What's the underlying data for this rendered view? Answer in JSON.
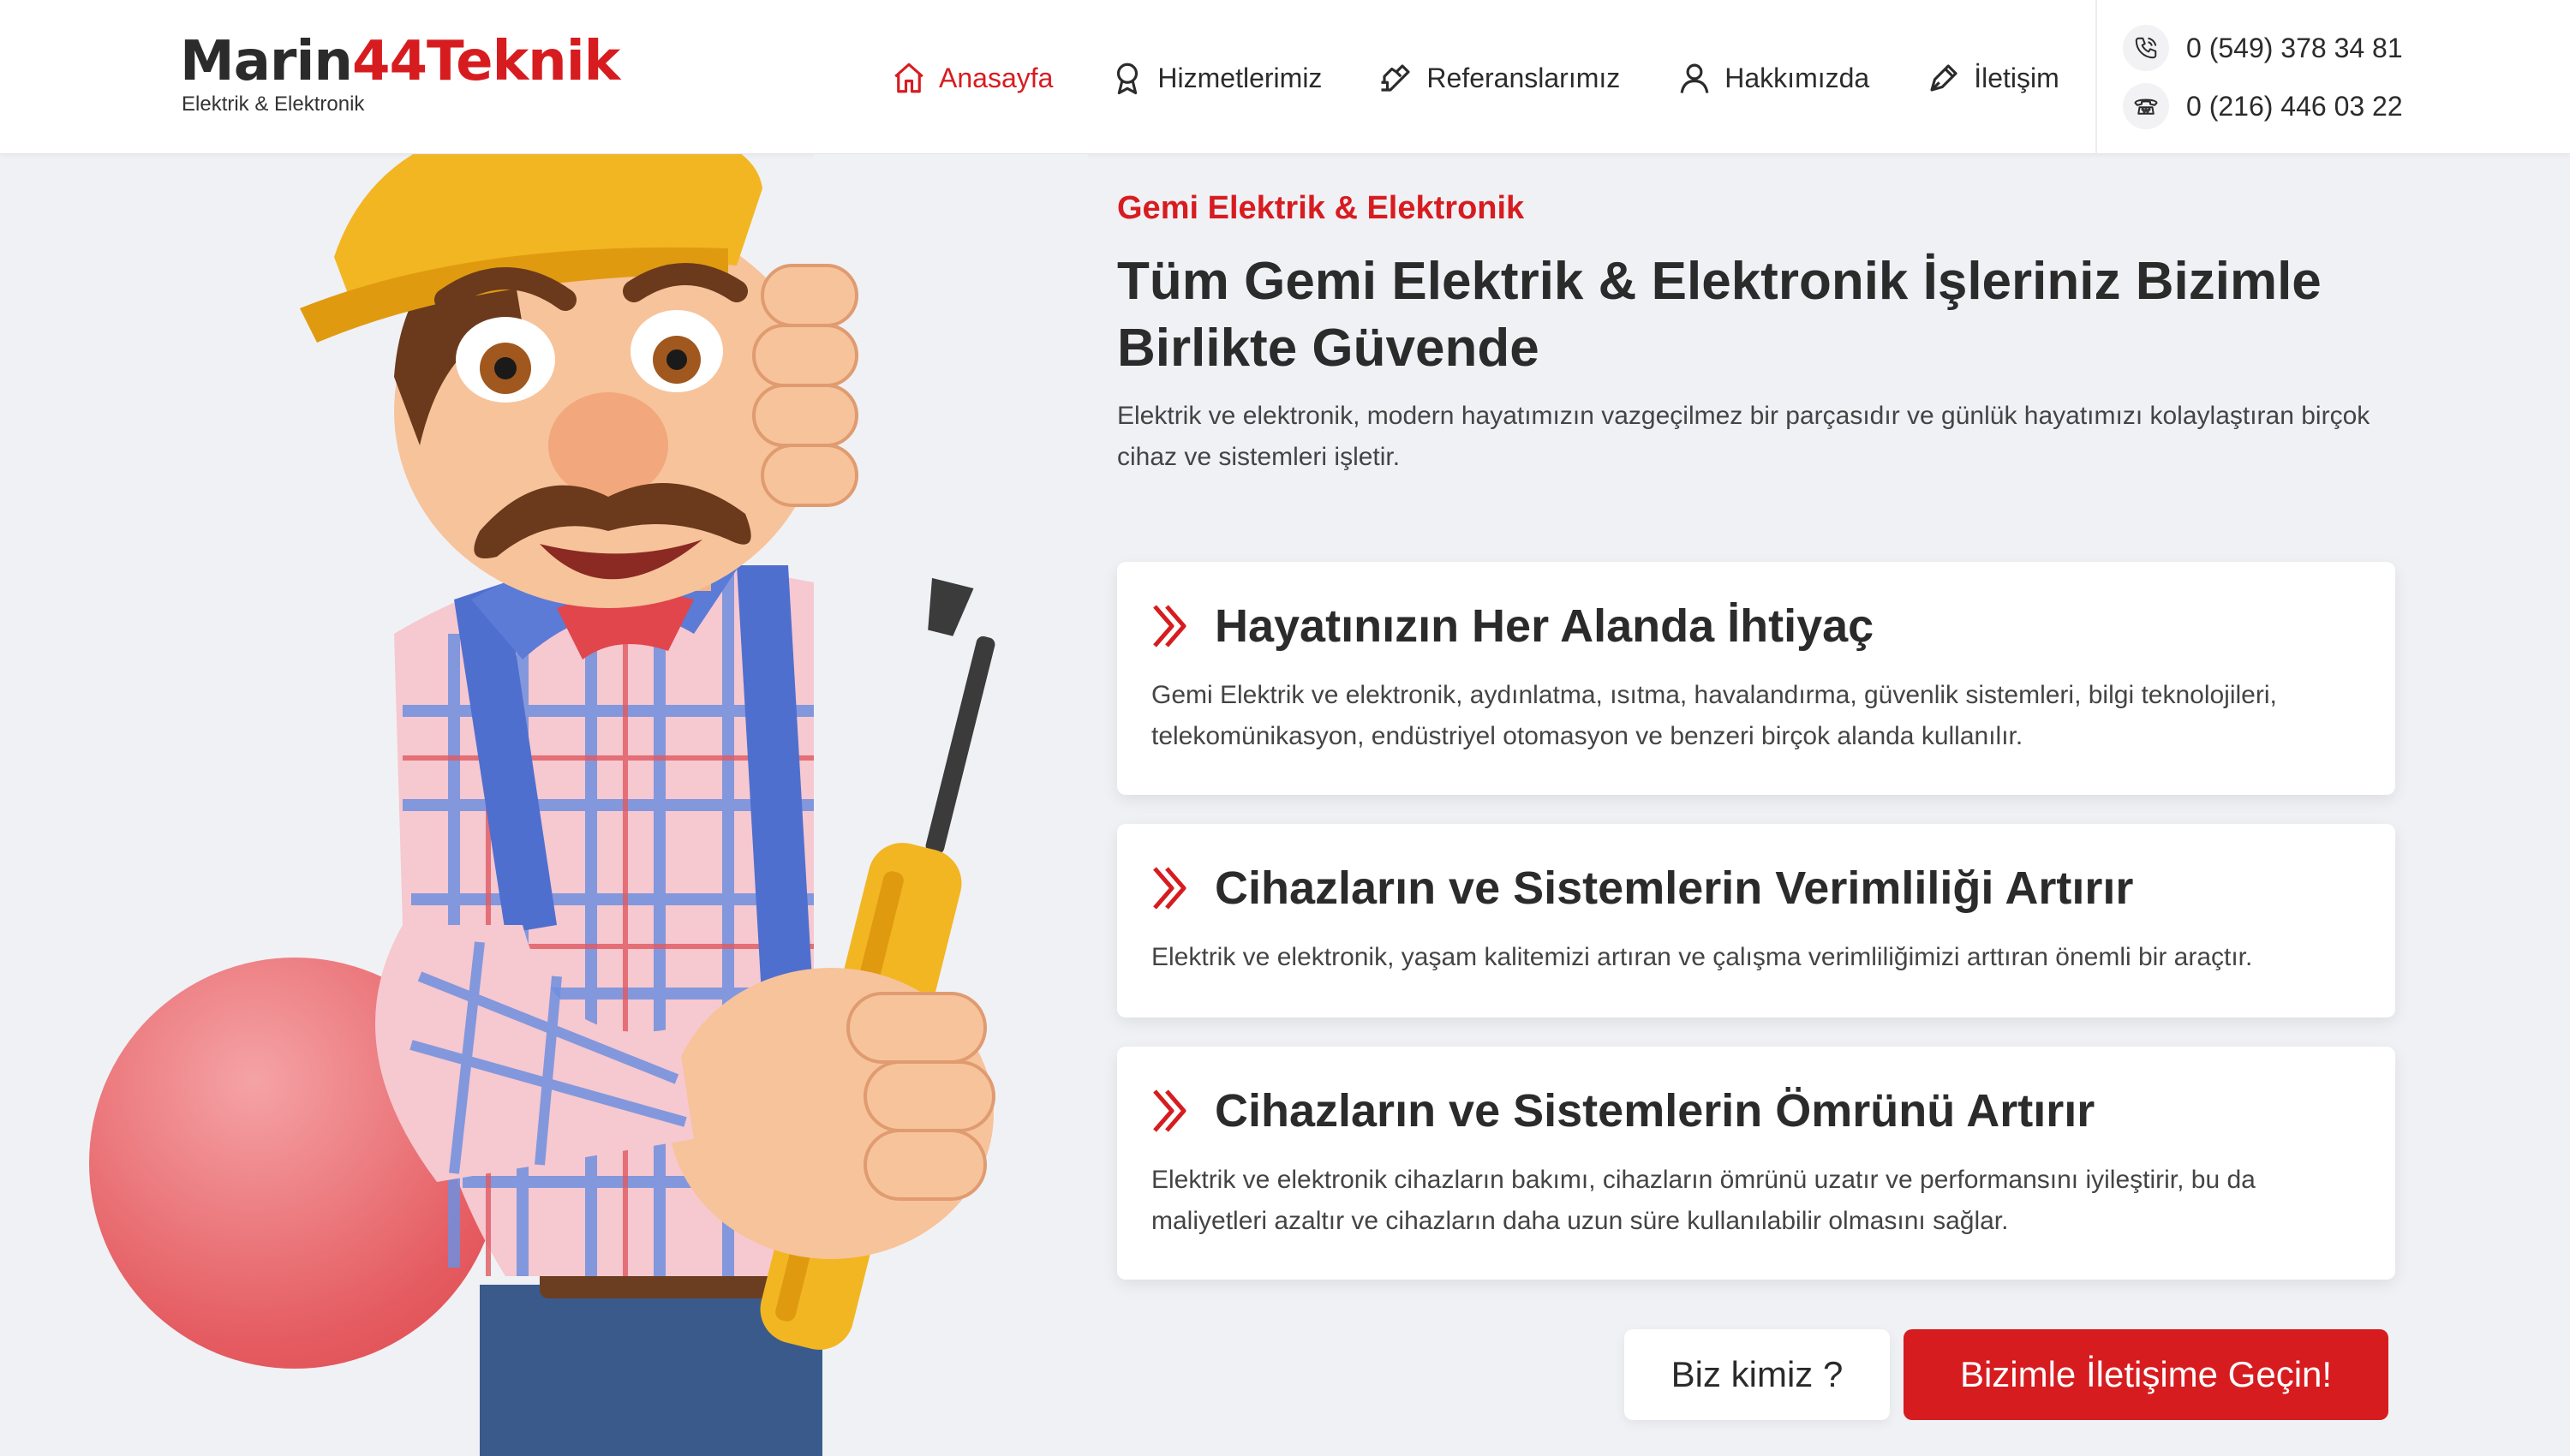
{
  "brand": {
    "name_dark": "Marin",
    "name_red": "44Teknik",
    "tagline": "Elektrik & Elektronik",
    "accent_color": "#d71c20",
    "text_color": "#2b2b2b"
  },
  "nav": {
    "items": [
      {
        "label": "Anasayfa",
        "icon": "home-icon",
        "active": true
      },
      {
        "label": "Hizmetlerimiz",
        "icon": "award-icon",
        "active": false
      },
      {
        "label": "Referanslarımız",
        "icon": "handshake-icon",
        "active": false
      },
      {
        "label": "Hakkımızda",
        "icon": "user-icon",
        "active": false
      },
      {
        "label": "İletişim",
        "icon": "pen-icon",
        "active": false
      }
    ]
  },
  "contact": {
    "mobile": "0 (549) 378 34 81",
    "landline": "0 (216) 446 03 22",
    "mobile_icon": "phone-call-icon",
    "landline_icon": "telephone-icon"
  },
  "hero": {
    "eyebrow": "Gemi Elektrik & Elektronik",
    "title": "Tüm Gemi Elektrik & Elektronik İşleriniz Bizimle Birlikte Güvende",
    "description": "Elektrik ve elektronik, modern hayatımızın vazgeçilmez bir parçasıdır ve günlük hayatımızı kolaylaştıran birçok cihaz ve sistemleri işletir.",
    "illustration": "electrician-worker-illustration"
  },
  "features": [
    {
      "icon": "chevron-right-icon",
      "title": "Hayatınızın Her Alanda İhtiyaç",
      "text": "Gemi Elektrik ve elektronik, aydınlatma, ısıtma, havalandırma, güvenlik sistemleri, bilgi teknolojileri, telekomünikasyon, endüstriyel otomasyon ve benzeri birçok alanda kullanılır."
    },
    {
      "icon": "chevron-right-icon",
      "title": "Cihazların ve Sistemlerin Verimliliği Artırır",
      "text": "Elektrik ve elektronik, yaşam kalitemizi artıran ve çalışma verimliliğimizi arttıran önemli bir araçtır."
    },
    {
      "icon": "chevron-right-icon",
      "title": "Cihazların ve Sistemlerin Ömrünü Artırır",
      "text": "Elektrik ve elektronik cihazların bakımı, cihazların ömrünü uzatır ve performansını iyileştirir, bu da maliyetleri azaltır ve cihazların daha uzun süre kullanılabilir olmasını sağlar."
    }
  ],
  "actions": {
    "about_label": "Biz kimiz ?",
    "contact_label": "Bizimle İletişime Geçin!"
  }
}
